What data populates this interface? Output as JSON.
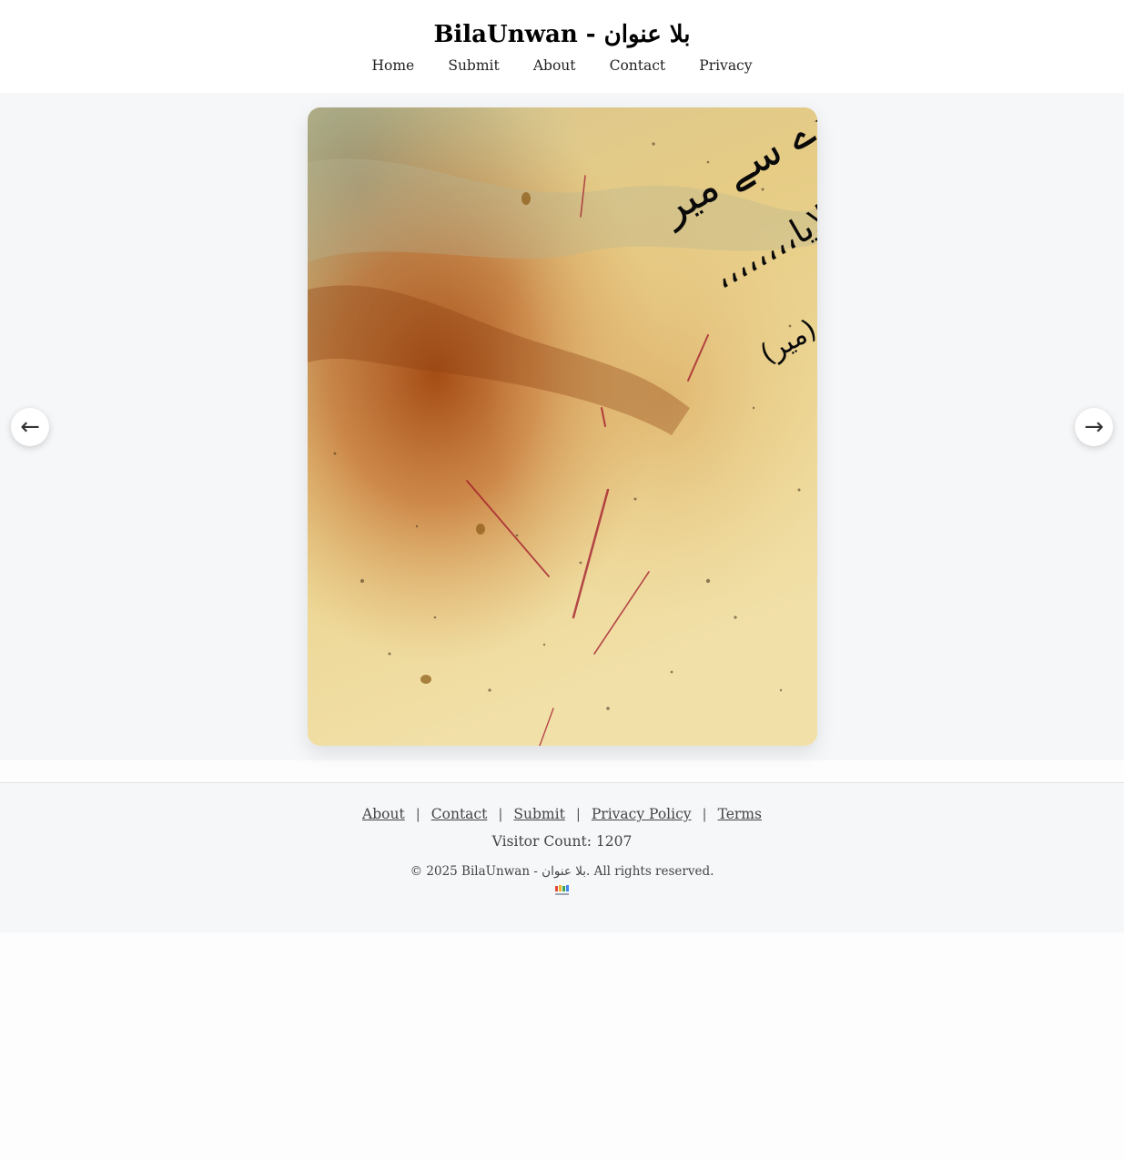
{
  "header": {
    "title": "BilaUnwan - بلا عنوان"
  },
  "nav": {
    "items": [
      {
        "label": "Home"
      },
      {
        "label": "Submit"
      },
      {
        "label": "About"
      },
      {
        "label": "Contact"
      },
      {
        "label": "Privacy"
      }
    ]
  },
  "gallery": {
    "prev_icon": "←",
    "next_icon": "→",
    "poster": {
      "lines": [
        "اب تو جاتے ہیں میکدے سے میر",
        "پھر ملیں گے اگر خدا لایا،،،،،،،،",
        "(میر)"
      ],
      "colors": {
        "paper": "#ecd79a",
        "rust": "#b45a1c",
        "ink": "#0a0a0a",
        "streak": "#a0142a"
      }
    }
  },
  "footer": {
    "links": [
      {
        "label": "About"
      },
      {
        "label": "Contact"
      },
      {
        "label": "Submit"
      },
      {
        "label": "Privacy Policy"
      },
      {
        "label": "Terms"
      }
    ],
    "separator": "|",
    "visitor_count": "Visitor Count: 1207",
    "copyright": "© 2025 BilaUnwan - بلا عنوان. All rights reserved."
  }
}
